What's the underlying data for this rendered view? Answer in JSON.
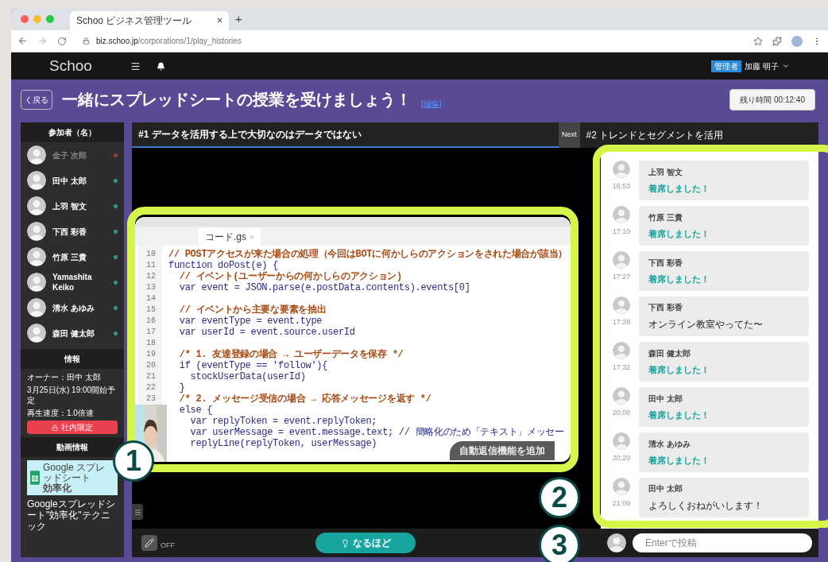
{
  "browser": {
    "tab_title": "Schoo ビジネス管理ツール",
    "tab_close": "×",
    "new_tab": "+",
    "url_domain": "biz.schoo.jp",
    "url_path": "/corporations/1/play_histories"
  },
  "header": {
    "logo": "Schoo",
    "role_badge": "管理者",
    "user": "加藤 明子"
  },
  "title_bar": {
    "back": "く戻る",
    "title": "一緒にスプレッドシートの授業を受けましょう！",
    "edit_link": "[編集]",
    "remaining": "残り時間 00:12:40"
  },
  "sidebar": {
    "participants_heading": "参加者（名）",
    "participants": [
      {
        "name": "金子 次郎",
        "online": false
      },
      {
        "name": "田中 太郎",
        "online": true
      },
      {
        "name": "上羽 智文",
        "online": true
      },
      {
        "name": "下西 彩香",
        "online": true
      },
      {
        "name": "竹原 三貴",
        "online": true
      },
      {
        "name": "Yamashita Keiko",
        "online": true
      },
      {
        "name": "清水 あゆみ",
        "online": true
      },
      {
        "name": "森田 健太郎",
        "online": true
      }
    ],
    "info_heading": "情報",
    "info_lines": [
      "オーナー：田中 太郎",
      "3月25日(水) 19:00開始予定",
      "再生速度：1.0倍速"
    ],
    "restriction_badge": "社内限定",
    "video_info_heading": "動画情報",
    "thumbnail_small": "Google スプレッドシート",
    "thumbnail_title": "効率化",
    "video_title": "Googleスプレッドシート\"効率化\"テクニック"
  },
  "player": {
    "current_chapter": "#1 データを活用する上で大切なのはデータではない",
    "next_label": "Next",
    "next_chapter": "#2 トレンドとセグメントを活用",
    "editor_tab": "コード.gs",
    "editor_tab_close": "×",
    "code": [
      {
        "no": "10",
        "kind": "comment",
        "text": "// POSTアクセスが来た場合の処理（今回はBOTに何かしらのアクションをされた場合が該当）"
      },
      {
        "no": "11",
        "kind": "code",
        "text": "function doPost(e) {"
      },
      {
        "no": "12",
        "kind": "comment",
        "text": "  // イベント(ユーザーからの何かしらのアクション)"
      },
      {
        "no": "13",
        "kind": "code",
        "text": "  var event = JSON.parse(e.postData.contents).events[0]"
      },
      {
        "no": "14",
        "kind": "code"
      },
      {
        "no": "15",
        "kind": "comment",
        "text": "  // イベントから主要な要素を抽出"
      },
      {
        "no": "16",
        "kind": "code",
        "text": "  var eventType = event.type"
      },
      {
        "no": "17",
        "kind": "code",
        "text": "  var userId = event.source.userId"
      },
      {
        "no": "18",
        "kind": "code"
      },
      {
        "no": "19",
        "kind": "comment",
        "text": "  /* 1. 友達登録の場合 → ユーザーデータを保存 */"
      },
      {
        "no": "20",
        "kind": "code",
        "text": "  if (eventType == 'follow'){"
      },
      {
        "no": "21",
        "kind": "code",
        "text": "    stockUserData(userId)"
      },
      {
        "no": "22",
        "kind": "code",
        "text": "  }"
      },
      {
        "no": "23",
        "kind": "comment",
        "text": "  /* 2. メッセージ受信の場合 → 応答メッセージを返す */"
      },
      {
        "kind": "code",
        "text": "  else {"
      },
      {
        "kind": "code",
        "text": "    var replyToken = event.replyToken;"
      },
      {
        "kind": "code",
        "text": "    var userMessage = event.message.text; // 簡略化のため「テキスト」メッセー"
      },
      {
        "kind": "code",
        "text": "    replyLine(replyToken, userMessage)"
      }
    ],
    "caption": "自動返信機能を追加",
    "pen_state": "OFF",
    "reaction_button": "なるほど"
  },
  "chat": {
    "messages": [
      {
        "name": "上羽 智文",
        "time": "16:53",
        "text": "着席しました！",
        "kind": "system"
      },
      {
        "name": "竹原 三貴",
        "time": "17:10",
        "text": "着席しました！",
        "kind": "system"
      },
      {
        "name": "下西 彩香",
        "time": "17:27",
        "text": "着席しました！",
        "kind": "system"
      },
      {
        "name": "下西 彩香",
        "time": "17:28",
        "text": "オンライン教室やってた〜",
        "kind": "message"
      },
      {
        "name": "森田 健太郎",
        "time": "17:32",
        "text": "着席しました！",
        "kind": "system"
      },
      {
        "name": "田中 太郎",
        "time": "20:08",
        "text": "着席しました！",
        "kind": "system"
      },
      {
        "name": "清水 あゆみ",
        "time": "20:20",
        "text": "着席しました！",
        "kind": "system"
      },
      {
        "name": "田中 太郎",
        "time": "21:09",
        "text": "よろしくおねがいします！",
        "kind": "message"
      }
    ],
    "input_placeholder": "Enterで投稿"
  },
  "callouts": [
    "1",
    "2",
    "3"
  ]
}
